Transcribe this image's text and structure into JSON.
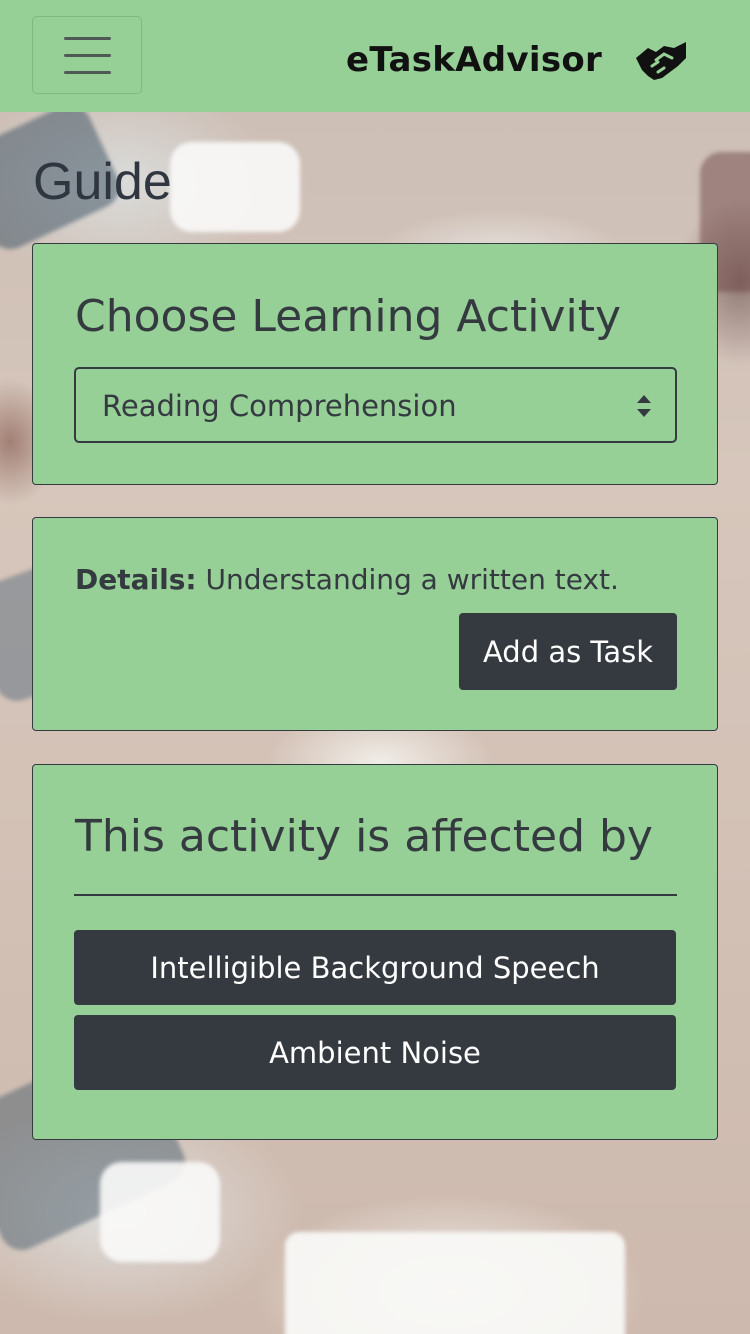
{
  "navbar": {
    "menu_icon": "hamburger-menu-icon",
    "brand": "eTaskAdvisor",
    "brand_icon": "handshake-icon",
    "background_color": "#96d096"
  },
  "page": {
    "title": "Guide"
  },
  "activity_card": {
    "title": "Choose Learning Activity",
    "select_value": "Reading Comprehension",
    "select_icon": "select-arrows-icon"
  },
  "details_card": {
    "label": "Details:",
    "text": " Understanding a written text.",
    "add_button": "Add as Task"
  },
  "factors_card": {
    "title": "This activity is affected by",
    "factors": [
      "Intelligible Background Speech",
      "Ambient Noise"
    ]
  },
  "colors": {
    "card_background": "#96d096",
    "button_background": "#343a40",
    "button_text": "#ffffff",
    "text": "#343a40"
  }
}
